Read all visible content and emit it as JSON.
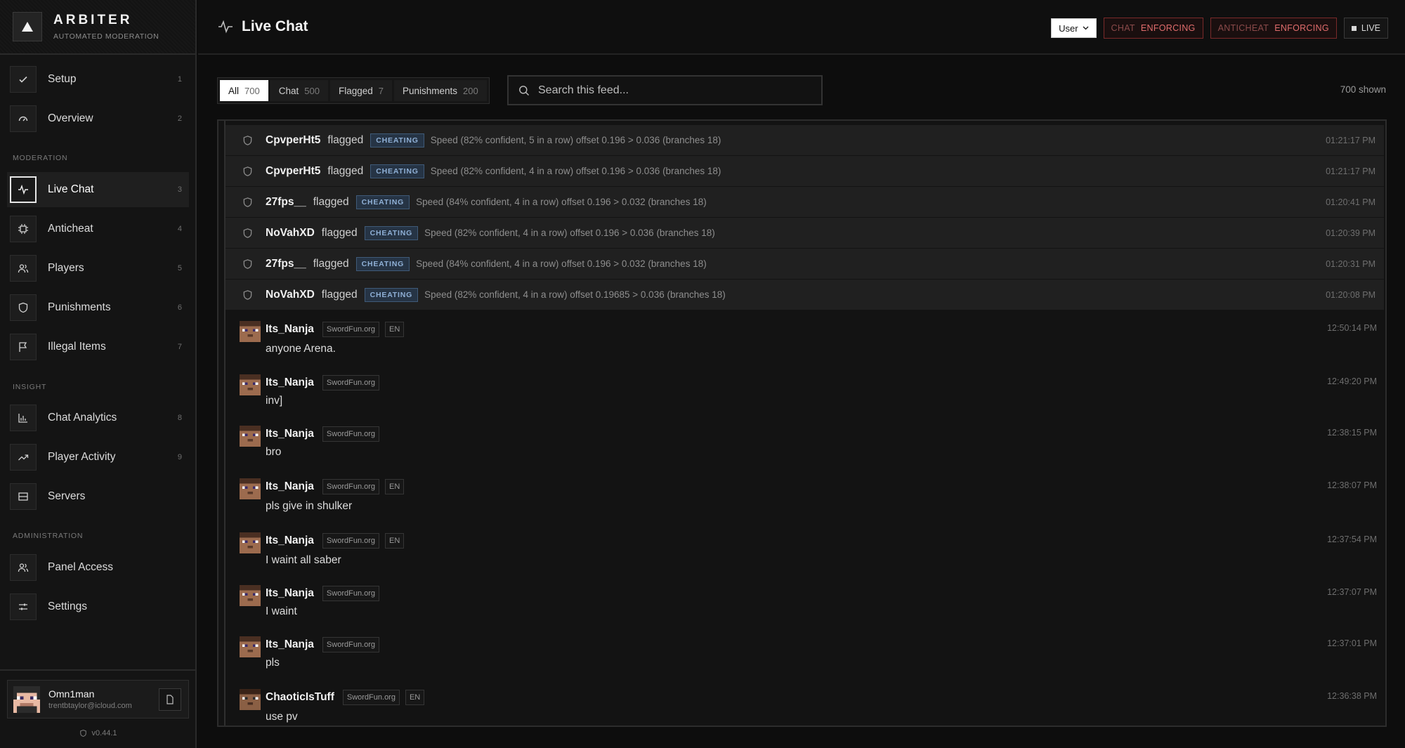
{
  "brand": {
    "name": "ARBITER",
    "subtitle": "AUTOMATED MODERATION"
  },
  "nav": {
    "setup": {
      "label": "Setup",
      "num": "1"
    },
    "overview": {
      "label": "Overview",
      "num": "2"
    },
    "section_moderation": "MODERATION",
    "live_chat": {
      "label": "Live Chat",
      "num": "3"
    },
    "anticheat": {
      "label": "Anticheat",
      "num": "4"
    },
    "players": {
      "label": "Players",
      "num": "5"
    },
    "punishments": {
      "label": "Punishments",
      "num": "6"
    },
    "illegal_items": {
      "label": "Illegal Items",
      "num": "7"
    },
    "section_insight": "INSIGHT",
    "chat_analytics": {
      "label": "Chat Analytics",
      "num": "8"
    },
    "player_activity": {
      "label": "Player Activity",
      "num": "9"
    },
    "servers": {
      "label": "Servers"
    },
    "section_administration": "ADMINISTRATION",
    "panel_access": {
      "label": "Panel Access"
    },
    "settings": {
      "label": "Settings"
    }
  },
  "user": {
    "name": "Omn1man",
    "email": "trentbtaylor@icloud.com"
  },
  "version": "v0.44.1",
  "header": {
    "title": "Live Chat",
    "role_select": "User",
    "chat_status": {
      "key": "CHAT",
      "value": "ENFORCING"
    },
    "anticheat_status": {
      "key": "ANTICHEAT",
      "value": "ENFORCING"
    },
    "live_label": "LIVE"
  },
  "filters": {
    "all": {
      "label": "All",
      "count": "700"
    },
    "chat": {
      "label": "Chat",
      "count": "500"
    },
    "flagged": {
      "label": "Flagged",
      "count": "7"
    },
    "punishments": {
      "label": "Punishments",
      "count": "200"
    }
  },
  "search": {
    "placeholder": "Search this feed..."
  },
  "shown_count": "700 shown",
  "flag_tag": "CHEATING",
  "flags": [
    {
      "player": "CpvperHt5",
      "verb": "flagged",
      "detail": "Speed (82% confident, 5 in a row) offset 0.196 > 0.036 (branches 18)",
      "time": "01:21:17 PM"
    },
    {
      "player": "CpvperHt5",
      "verb": "flagged",
      "detail": "Speed (82% confident, 4 in a row) offset 0.196 > 0.036 (branches 18)",
      "time": "01:21:17 PM"
    },
    {
      "player": "27fps__",
      "verb": "flagged",
      "detail": "Speed (84% confident, 4 in a row) offset 0.196 > 0.032 (branches 18)",
      "time": "01:20:41 PM"
    },
    {
      "player": "NoVahXD",
      "verb": "flagged",
      "detail": "Speed (82% confident, 4 in a row) offset 0.196 > 0.036 (branches 18)",
      "time": "01:20:39 PM"
    },
    {
      "player": "27fps__",
      "verb": "flagged",
      "detail": "Speed (84% confident, 4 in a row) offset 0.196 > 0.032 (branches 18)",
      "time": "01:20:31 PM"
    },
    {
      "player": "NoVahXD",
      "verb": "flagged",
      "detail": "Speed (82% confident, 4 in a row) offset 0.19685 > 0.036 (branches 18)",
      "time": "01:20:08 PM"
    }
  ],
  "messages": [
    {
      "player": "Its_Nanja",
      "server": "SwordFun.org",
      "lang": "EN",
      "text": "anyone Arena.",
      "time": "12:50:14 PM"
    },
    {
      "player": "Its_Nanja",
      "server": "SwordFun.org",
      "lang": "",
      "text": "inv]",
      "time": "12:49:20 PM"
    },
    {
      "player": "Its_Nanja",
      "server": "SwordFun.org",
      "lang": "",
      "text": "bro",
      "time": "12:38:15 PM"
    },
    {
      "player": "Its_Nanja",
      "server": "SwordFun.org",
      "lang": "EN",
      "text": "pls give in shulker",
      "time": "12:38:07 PM"
    },
    {
      "player": "Its_Nanja",
      "server": "SwordFun.org",
      "lang": "EN",
      "text": "I waint all saber",
      "time": "12:37:54 PM"
    },
    {
      "player": "Its_Nanja",
      "server": "SwordFun.org",
      "lang": "",
      "text": "I waint",
      "time": "12:37:07 PM"
    },
    {
      "player": "Its_Nanja",
      "server": "SwordFun.org",
      "lang": "",
      "text": "pls",
      "time": "12:37:01 PM"
    },
    {
      "player": "ChaoticIsTuff",
      "server": "SwordFun.org",
      "lang": "EN",
      "text": "use pv",
      "time": "12:36:38 PM"
    }
  ],
  "colors": {
    "accent_red": "#e06c6c",
    "tag_blue": "#8fb0d6",
    "background": "#0d0d0d"
  }
}
